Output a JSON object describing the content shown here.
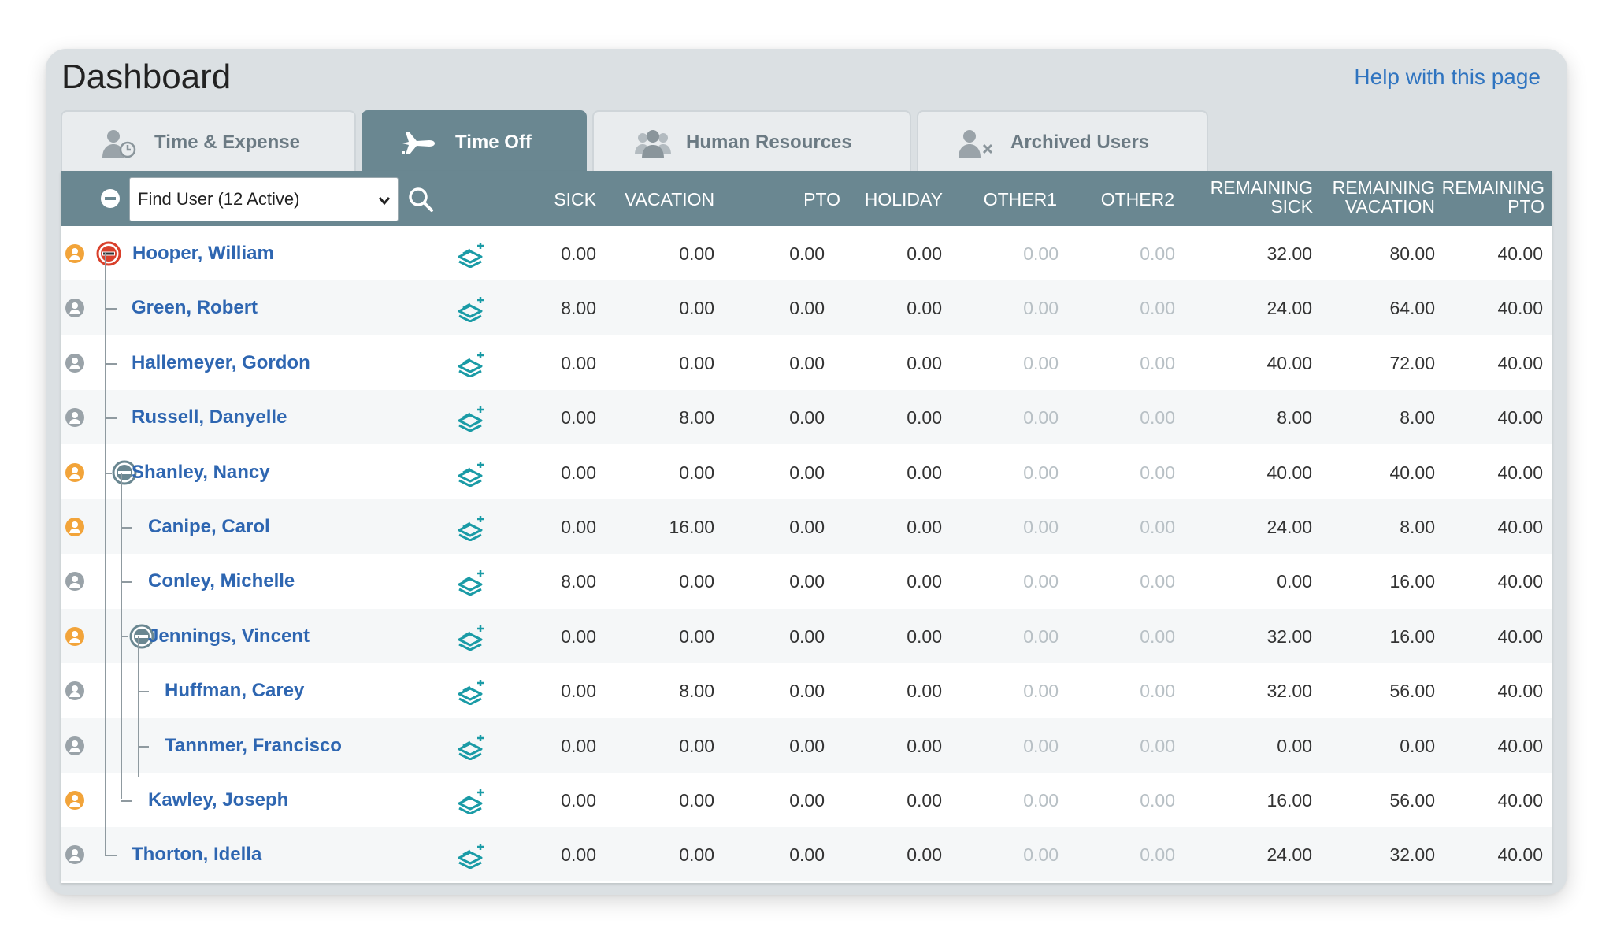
{
  "page": {
    "title": "Dashboard",
    "help_link": "Help with this page"
  },
  "tabs": [
    {
      "label": "Time & Expense",
      "icon": "user-clock-icon",
      "active": false
    },
    {
      "label": "Time Off",
      "icon": "airplane-icon",
      "active": true
    },
    {
      "label": "Human Resources",
      "icon": "users-group-icon",
      "active": false
    },
    {
      "label": "Archived Users",
      "icon": "user-remove-icon",
      "active": false
    }
  ],
  "toolbar": {
    "find_user_value": "Find User (12 Active)"
  },
  "columns": {
    "sick": "SICK",
    "vacation": "VACATION",
    "pto": "PTO",
    "holiday": "HOLIDAY",
    "other1": "OTHER1",
    "other2": "OTHER2",
    "remaining_sick_1": "REMAINING",
    "remaining_sick_2": "SICK",
    "remaining_vacation_1": "REMAINING",
    "remaining_vacation_2": "VACATION",
    "remaining_pto_1": "REMAINING",
    "remaining_pto_2": "PTO"
  },
  "colors": {
    "accent": "#6a8791",
    "link": "#2e66b1",
    "status_orange": "#f2a43a",
    "status_gray": "#9aa3a9",
    "add_icon": "#1a9ba6",
    "collapse_red": "#d9402b"
  },
  "users": [
    {
      "name": "Hooper, William",
      "status": "orange",
      "level": 0,
      "collapsible": true,
      "values": [
        "0.00",
        "0.00",
        "0.00",
        "0.00",
        "0.00",
        "0.00",
        "32.00",
        "80.00",
        "40.00"
      ]
    },
    {
      "name": "Green, Robert",
      "status": "gray",
      "level": 1,
      "collapsible": false,
      "values": [
        "8.00",
        "0.00",
        "0.00",
        "0.00",
        "0.00",
        "0.00",
        "24.00",
        "64.00",
        "40.00"
      ]
    },
    {
      "name": "Hallemeyer, Gordon",
      "status": "gray",
      "level": 1,
      "collapsible": false,
      "values": [
        "0.00",
        "0.00",
        "0.00",
        "0.00",
        "0.00",
        "0.00",
        "40.00",
        "72.00",
        "40.00"
      ]
    },
    {
      "name": "Russell, Danyelle",
      "status": "gray",
      "level": 1,
      "collapsible": false,
      "values": [
        "0.00",
        "8.00",
        "0.00",
        "0.00",
        "0.00",
        "0.00",
        "8.00",
        "8.00",
        "40.00"
      ]
    },
    {
      "name": "Shanley, Nancy",
      "status": "orange",
      "level": 1,
      "collapsible": true,
      "values": [
        "0.00",
        "0.00",
        "0.00",
        "0.00",
        "0.00",
        "0.00",
        "40.00",
        "40.00",
        "40.00"
      ]
    },
    {
      "name": "Canipe, Carol",
      "status": "orange",
      "level": 2,
      "collapsible": false,
      "values": [
        "0.00",
        "16.00",
        "0.00",
        "0.00",
        "0.00",
        "0.00",
        "24.00",
        "8.00",
        "40.00"
      ]
    },
    {
      "name": "Conley, Michelle",
      "status": "gray",
      "level": 2,
      "collapsible": false,
      "values": [
        "8.00",
        "0.00",
        "0.00",
        "0.00",
        "0.00",
        "0.00",
        "0.00",
        "16.00",
        "40.00"
      ]
    },
    {
      "name": "Jennings, Vincent",
      "status": "orange",
      "level": 2,
      "collapsible": true,
      "values": [
        "0.00",
        "0.00",
        "0.00",
        "0.00",
        "0.00",
        "0.00",
        "32.00",
        "16.00",
        "40.00"
      ]
    },
    {
      "name": "Huffman, Carey",
      "status": "gray",
      "level": 3,
      "collapsible": false,
      "values": [
        "0.00",
        "8.00",
        "0.00",
        "0.00",
        "0.00",
        "0.00",
        "32.00",
        "56.00",
        "40.00"
      ]
    },
    {
      "name": "Tannmer, Francisco",
      "status": "gray",
      "level": 3,
      "collapsible": false,
      "values": [
        "0.00",
        "0.00",
        "0.00",
        "0.00",
        "0.00",
        "0.00",
        "0.00",
        "0.00",
        "40.00"
      ]
    },
    {
      "name": "Kawley, Joseph",
      "status": "orange",
      "level": 2,
      "collapsible": false,
      "values": [
        "0.00",
        "0.00",
        "0.00",
        "0.00",
        "0.00",
        "0.00",
        "16.00",
        "56.00",
        "40.00"
      ]
    },
    {
      "name": "Thorton, Idella",
      "status": "gray",
      "level": 1,
      "collapsible": false,
      "values": [
        "0.00",
        "0.00",
        "0.00",
        "0.00",
        "0.00",
        "0.00",
        "24.00",
        "32.00",
        "40.00"
      ]
    }
  ]
}
